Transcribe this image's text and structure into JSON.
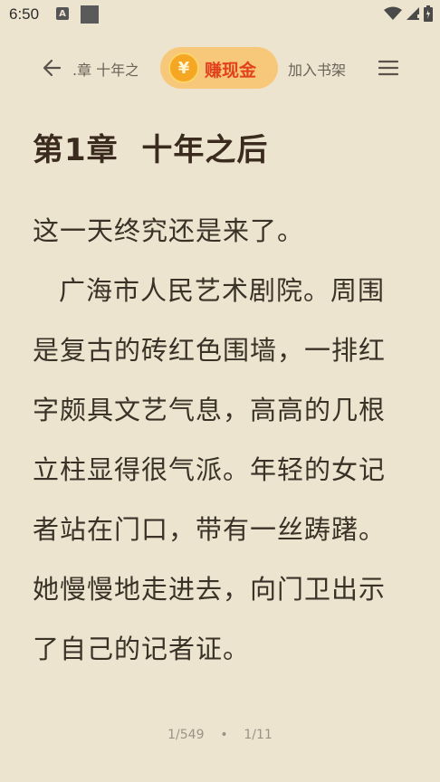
{
  "status_bar": {
    "time": "6:50",
    "notif_letter": "A"
  },
  "toolbar": {
    "chapter_short": ".章 十年之",
    "earn_label": "赚现金",
    "coin_symbol": "¥",
    "shelf_label": "加入书架"
  },
  "chapter": {
    "title": "第1章  十年之后"
  },
  "content": {
    "paragraphs": [
      "这一天终究还是来了。",
      "广海市人民艺术剧院。周围是复古的砖红色围墙，一排红字颇具文艺气息，高高的几根立柱显得很气派。年轻的女记者站在门口，带有一丝踌躇。她慢慢地走进去，向门卫出示了自己的记者证。"
    ]
  },
  "footer": {
    "page_progress": "1/549",
    "separator": "•",
    "chapter_progress": "1/11"
  },
  "colors": {
    "background": "#ece4cf",
    "accent": "#e1421d",
    "earn_bg": "#f7c879"
  }
}
